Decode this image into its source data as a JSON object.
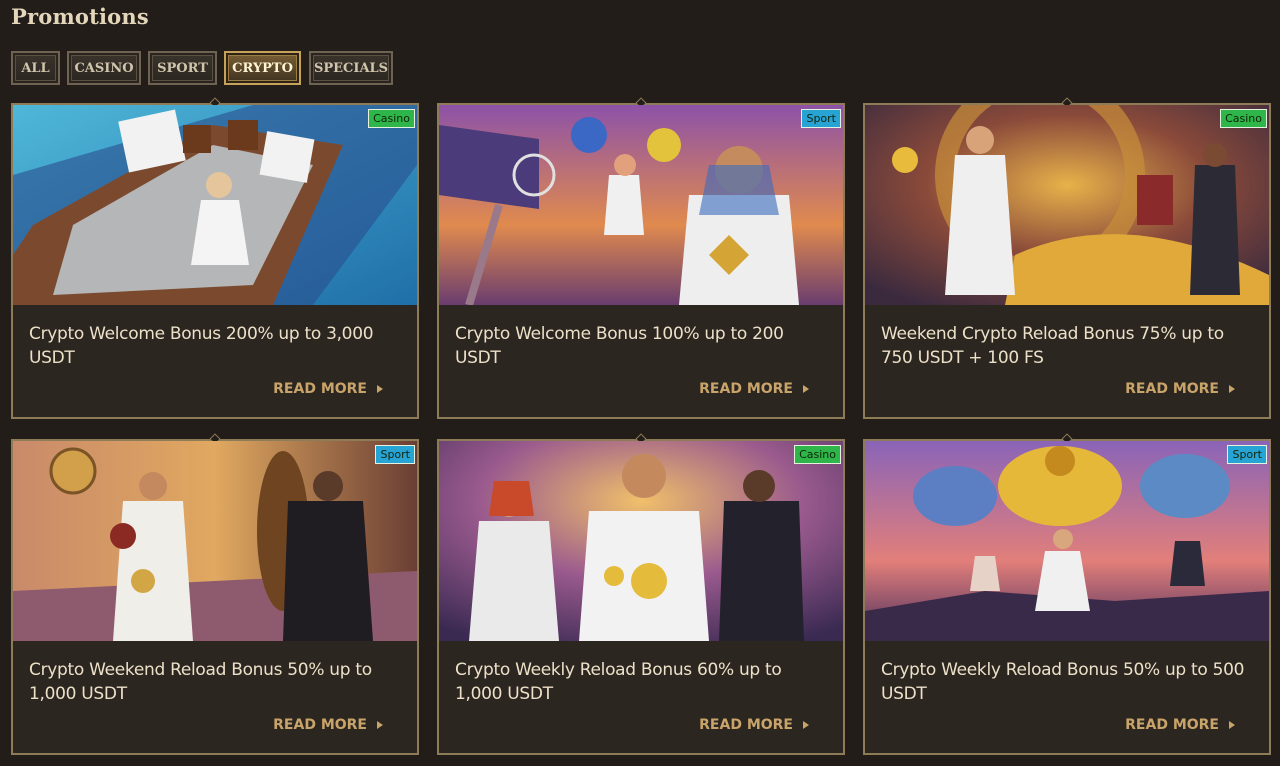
{
  "page_title": "Promotions",
  "filters": [
    {
      "label": "ALL",
      "active": false
    },
    {
      "label": "CASINO",
      "active": false
    },
    {
      "label": "SPORT",
      "active": false
    },
    {
      "label": "CRYPTO",
      "active": true
    },
    {
      "label": "SPECIALS",
      "active": false
    }
  ],
  "read_more_label": "READ MORE",
  "promotions": [
    {
      "title": "Crypto Welcome Bonus 200% up to 3,000 USDT",
      "category": "Casino",
      "image_icon": "pharaoh-speedboat-dice-image"
    },
    {
      "title": "Crypto Welcome Bonus 100% up to 200 USDT",
      "category": "Sport",
      "image_icon": "basketball-cheerleader-image"
    },
    {
      "title": "Weekend Crypto Reload Bonus 75% up to 750 USDT + 100 FS",
      "category": "Casino",
      "image_icon": "vault-coins-image"
    },
    {
      "title": "Crypto Weekend Reload Bonus 50% up to 1,000 USDT",
      "category": "Sport",
      "image_icon": "boxing-ring-image"
    },
    {
      "title": "Crypto Weekly Reload Bonus 60% up to 1,000 USDT",
      "category": "Casino",
      "image_icon": "pharaoh-rings-image"
    },
    {
      "title": "Crypto Weekly Reload Bonus 50% up to 500 USDT",
      "category": "Sport",
      "image_icon": "crypto-parachutes-image"
    }
  ],
  "colors": {
    "background": "#221d18",
    "card_border": "#8e7b57",
    "accent_gold": "#c9a46a",
    "casino_badge": "#2fb64a",
    "sport_badge": "#27a3d4"
  }
}
